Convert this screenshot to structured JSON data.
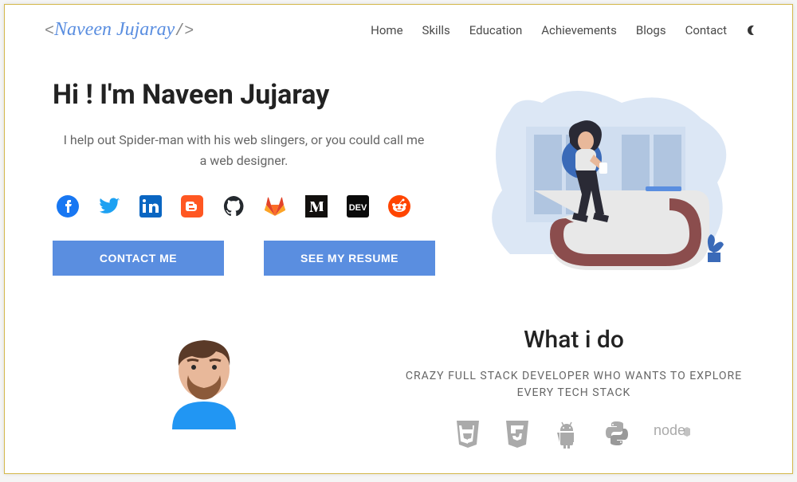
{
  "logo": {
    "name": "Naveen Jujaray"
  },
  "nav": {
    "home": "Home",
    "skills": "Skills",
    "education": "Education",
    "achievements": "Achievements",
    "blogs": "Blogs",
    "contact": "Contact"
  },
  "hero": {
    "title": "Hi ! I'm Naveen Jujaray",
    "subtitle": "I help out Spider-man with his web slingers, or you could call me a web designer."
  },
  "socials": {
    "facebook": "facebook-icon",
    "twitter": "twitter-icon",
    "linkedin": "linkedin-icon",
    "blogger": "blogger-icon",
    "github": "github-icon",
    "gitlab": "gitlab-icon",
    "medium": "medium-icon",
    "dev": "dev-icon",
    "reddit": "reddit-icon"
  },
  "buttons": {
    "contact": "CONTACT ME",
    "resume": "SEE MY RESUME"
  },
  "whatido": {
    "title": "What i do",
    "subtitle": "CRAZY FULL STACK DEVELOPER WHO WANTS TO EXPLORE EVERY TECH STACK"
  },
  "techs": {
    "html5": "html5-icon",
    "css3": "css3-icon",
    "android": "android-icon",
    "python": "python-icon",
    "node": "node-icon"
  },
  "colors": {
    "accent": "#5a8ee0"
  }
}
